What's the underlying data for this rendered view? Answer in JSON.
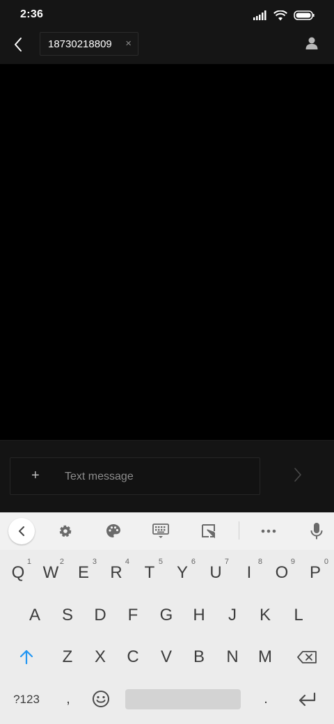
{
  "status_bar": {
    "time": "2:36"
  },
  "header": {
    "recipient": "18730218809",
    "remove_glyph": "×",
    "icons": {
      "back": "back-arrow-icon",
      "contact": "contact-person-icon"
    }
  },
  "composer": {
    "attach_glyph": "+",
    "placeholder": "Text message",
    "value": "",
    "icons": {
      "send": "send-chevron-icon"
    }
  },
  "keyboard": {
    "toolbar_icons": [
      "keyboard-collapse-icon",
      "settings-gear-icon",
      "theme-palette-icon",
      "one-handed-keyboard-icon",
      "floating-resize-icon",
      "more-dots-icon",
      "microphone-icon"
    ],
    "rows": [
      {
        "keys": [
          {
            "label": "Q",
            "hint": "1"
          },
          {
            "label": "W",
            "hint": "2"
          },
          {
            "label": "E",
            "hint": "3"
          },
          {
            "label": "R",
            "hint": "4"
          },
          {
            "label": "T",
            "hint": "5"
          },
          {
            "label": "Y",
            "hint": "6"
          },
          {
            "label": "U",
            "hint": "7"
          },
          {
            "label": "I",
            "hint": "8"
          },
          {
            "label": "O",
            "hint": "9"
          },
          {
            "label": "P",
            "hint": "0"
          }
        ]
      },
      {
        "keys": [
          {
            "label": "A"
          },
          {
            "label": "S"
          },
          {
            "label": "D"
          },
          {
            "label": "F"
          },
          {
            "label": "G"
          },
          {
            "label": "H"
          },
          {
            "label": "J"
          },
          {
            "label": "K"
          },
          {
            "label": "L"
          }
        ]
      },
      {
        "keys": [
          {
            "label": "Z"
          },
          {
            "label": "X"
          },
          {
            "label": "C"
          },
          {
            "label": "V"
          },
          {
            "label": "B"
          },
          {
            "label": "N"
          },
          {
            "label": "M"
          }
        ]
      }
    ],
    "bottom_row": {
      "symbols": "?123",
      "comma": ",",
      "period": ".",
      "enter_icon": "enter-return-icon"
    },
    "accent_color": "#2196f3"
  }
}
